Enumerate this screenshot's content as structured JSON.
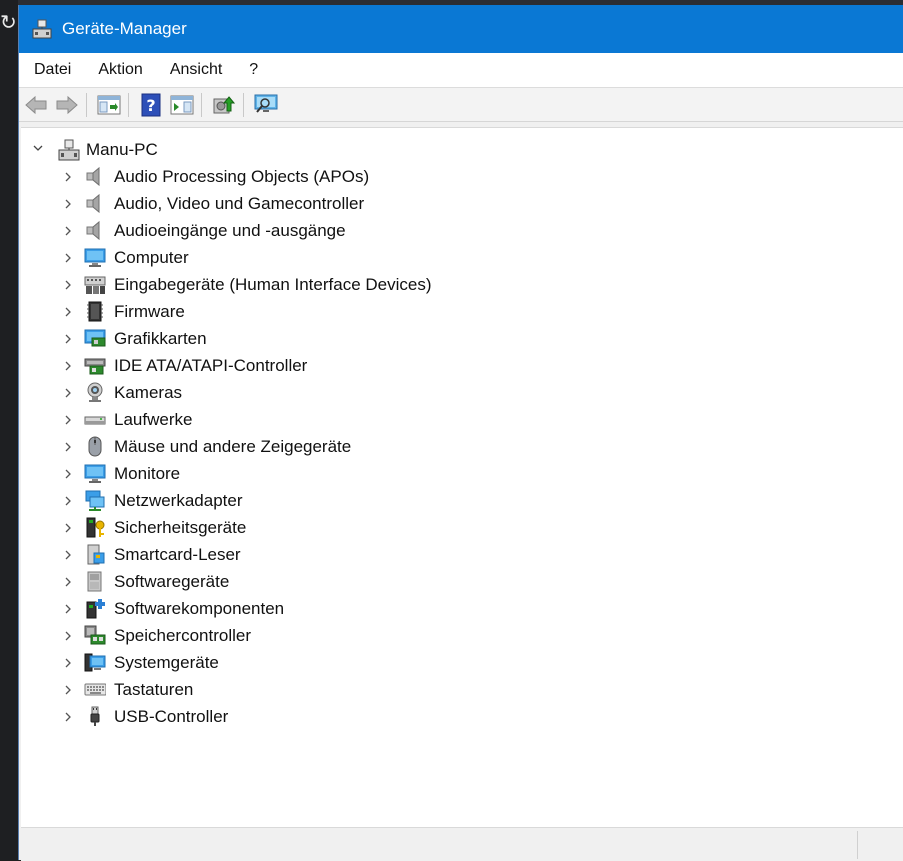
{
  "window": {
    "title": "Geräte-Manager"
  },
  "menu": [
    "Datei",
    "Aktion",
    "Ansicht",
    "?"
  ],
  "toolbar": [
    {
      "icon": "back-arrow-icon"
    },
    {
      "icon": "forward-arrow-icon"
    },
    {
      "icon": "show-hide-console-tree-icon"
    },
    {
      "icon": "help-icon"
    },
    {
      "icon": "action-pane-icon"
    },
    {
      "icon": "update-driver-icon"
    },
    {
      "icon": "scan-hardware-changes-icon"
    }
  ],
  "tree": {
    "root": {
      "label": "Manu-PC",
      "icon": "computer-tower-icon"
    },
    "items": [
      {
        "label": "Audio Processing Objects (APOs)",
        "icon": "speaker-icon"
      },
      {
        "label": "Audio, Video und Gamecontroller",
        "icon": "speaker-icon"
      },
      {
        "label": "Audioeingänge und -ausgänge",
        "icon": "speaker-icon"
      },
      {
        "label": "Computer",
        "icon": "monitor-icon"
      },
      {
        "label": "Eingabegeräte (Human Interface Devices)",
        "icon": "hid-icon"
      },
      {
        "label": "Firmware",
        "icon": "firmware-chip-icon"
      },
      {
        "label": "Grafikkarten",
        "icon": "display-adapter-icon"
      },
      {
        "label": "IDE ATA/ATAPI-Controller",
        "icon": "ide-controller-icon"
      },
      {
        "label": "Kameras",
        "icon": "webcam-icon"
      },
      {
        "label": "Laufwerke",
        "icon": "disk-drive-icon"
      },
      {
        "label": "Mäuse und andere Zeigegeräte",
        "icon": "mouse-icon"
      },
      {
        "label": "Monitore",
        "icon": "monitor-icon"
      },
      {
        "label": "Netzwerkadapter",
        "icon": "network-adapter-icon"
      },
      {
        "label": "Sicherheitsgeräte",
        "icon": "security-key-icon"
      },
      {
        "label": "Smartcard-Leser",
        "icon": "smartcard-reader-icon"
      },
      {
        "label": "Softwaregeräte",
        "icon": "software-device-icon"
      },
      {
        "label": "Softwarekomponenten",
        "icon": "software-component-icon"
      },
      {
        "label": "Speichercontroller",
        "icon": "storage-controller-icon"
      },
      {
        "label": "Systemgeräte",
        "icon": "system-device-icon"
      },
      {
        "label": "Tastaturen",
        "icon": "keyboard-icon"
      },
      {
        "label": "USB-Controller",
        "icon": "usb-plug-icon"
      }
    ]
  }
}
